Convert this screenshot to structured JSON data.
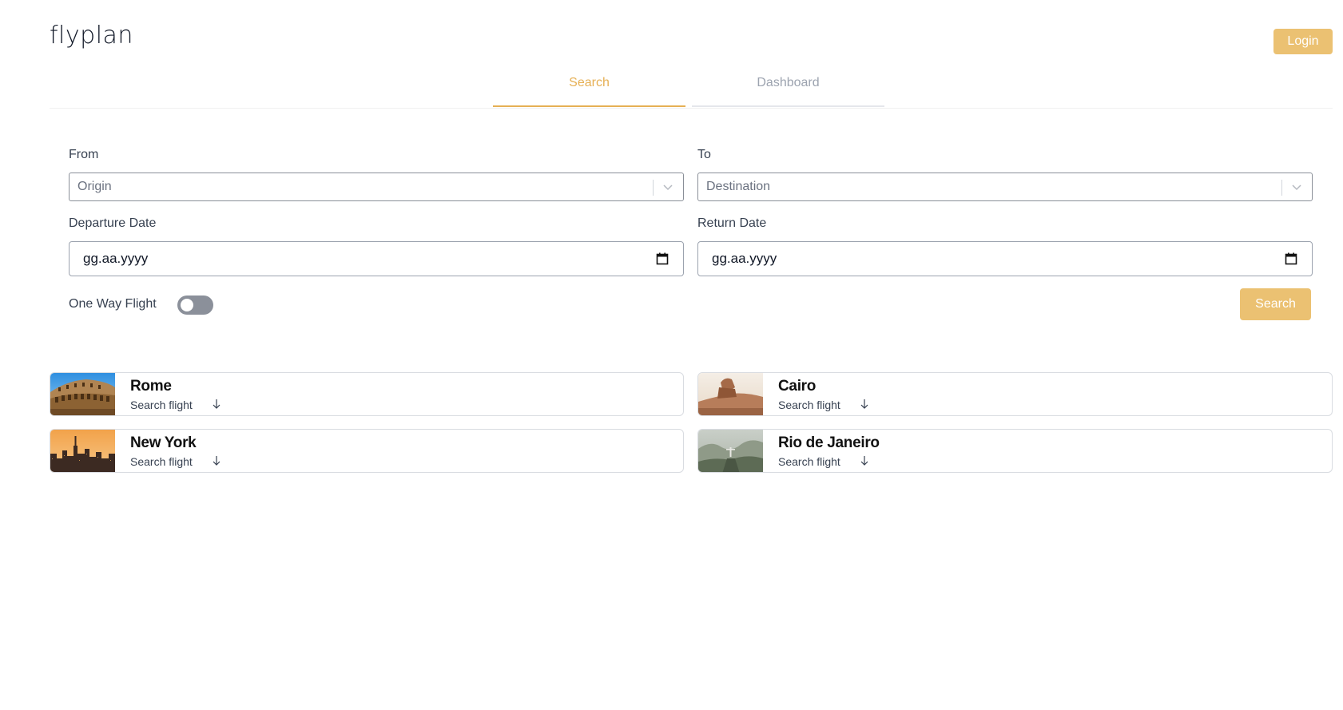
{
  "app": {
    "logo": "flyplan",
    "login_label": "Login"
  },
  "tabs": [
    {
      "label": "Search",
      "active": true
    },
    {
      "label": "Dashboard",
      "active": false
    }
  ],
  "form": {
    "from_label": "From",
    "from_placeholder": "Origin",
    "to_label": "To",
    "to_placeholder": "Destination",
    "departure_label": "Departure Date",
    "departure_value": "gg.aa.yyyy",
    "return_label": "Return Date",
    "return_value": "gg.aa.yyyy",
    "one_way_label": "One Way Flight",
    "one_way_on": false,
    "search_label": "Search"
  },
  "destinations": [
    {
      "city": "Rome",
      "action": "Search flight"
    },
    {
      "city": "Cairo",
      "action": "Search flight"
    },
    {
      "city": "New York",
      "action": "Search flight"
    },
    {
      "city": "Rio de Janeiro",
      "action": "Search flight"
    }
  ],
  "colors": {
    "accent": "#ebc172",
    "accent_text": "#e6b055",
    "toggle_off": "#8b909a"
  }
}
